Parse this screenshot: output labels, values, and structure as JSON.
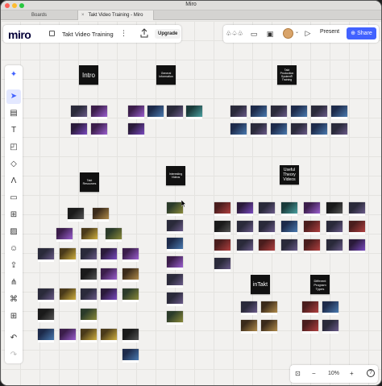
{
  "window": {
    "title": "Miro"
  },
  "tabs": [
    {
      "label": "Boards"
    },
    {
      "label": "Takt Video Training - Miro"
    }
  ],
  "header": {
    "logo": "miro",
    "board_name": "Takt Video Training",
    "upgrade_label": "Upgrade",
    "present_label": "Present",
    "share_label": "Share"
  },
  "toolbar": {
    "tools": [
      "sparkle-icon",
      "cursor-icon",
      "template-icon",
      "text-icon",
      "sticky-note-icon",
      "shapes-icon",
      "pen-icon",
      "comment-icon",
      "frame-icon",
      "image-icon",
      "emoji-icon",
      "upload-icon",
      "diagram-icon",
      "integrations-icon",
      "add-icon",
      "undo-icon",
      "redo-icon"
    ]
  },
  "zoom": {
    "level": "10%",
    "minus": "−",
    "plus": "+",
    "help": "?"
  },
  "frames": {
    "intro": "Intro",
    "general": "General Information",
    "takt_production": "Takt Production System® Training",
    "takt_resources": "Takt Resources",
    "interesting": "Interesting Videos",
    "useful_theory": "Useful Theory Videos",
    "intakt": "inTakt",
    "program_types": "Different Program Types"
  },
  "colors": {
    "accent": "#4262ff",
    "frame_bg": "#111111"
  }
}
